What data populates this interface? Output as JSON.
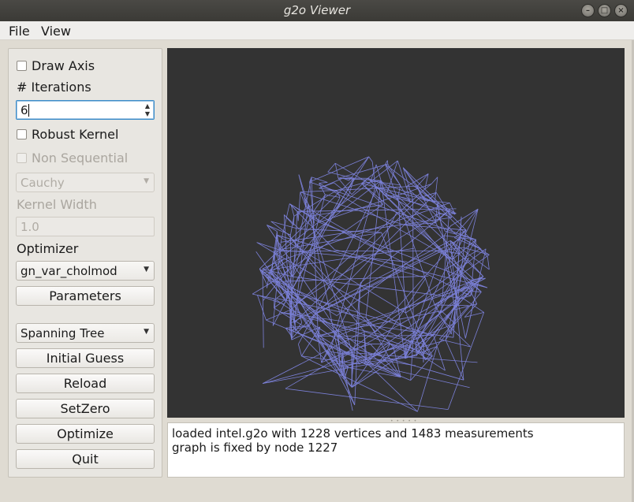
{
  "window": {
    "title": "g2o Viewer"
  },
  "menu": {
    "file": "File",
    "view": "View"
  },
  "panel": {
    "draw_axis": {
      "label": "Draw Axis",
      "checked": false
    },
    "iterations": {
      "label": "# Iterations",
      "value": "6"
    },
    "robust_kernel": {
      "label": "Robust Kernel",
      "checked": false
    },
    "non_sequential": {
      "label": "Non Sequential",
      "checked": false,
      "enabled": false
    },
    "kernel_select": {
      "value": "Cauchy",
      "enabled": false
    },
    "kernel_width": {
      "label": "Kernel Width",
      "value": "1.0",
      "enabled": false
    },
    "optimizer": {
      "label": "Optimizer",
      "value": "gn_var_cholmod"
    },
    "parameters_button": "Parameters",
    "initial_guess_select": {
      "value": "Spanning Tree"
    },
    "initial_guess_button": "Initial Guess",
    "reload_button": "Reload",
    "setzero_button": "SetZero",
    "optimize_button": "Optimize",
    "quit_button": "Quit"
  },
  "viewer": {
    "background": "#333333",
    "edge_color": "#7b80d8"
  },
  "log": [
    "loaded intel.g2o with 1228 vertices and 1483 measurements",
    "graph is fixed by node 1227"
  ],
  "icons": {
    "minimize": "minimize-icon",
    "maximize": "maximize-icon",
    "close": "close-icon"
  }
}
